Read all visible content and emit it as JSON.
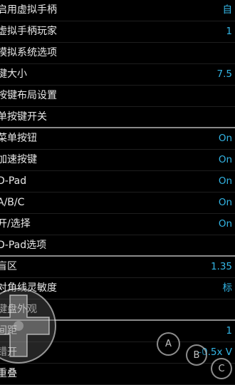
{
  "settings": [
    {
      "label": "启用虚拟手柄",
      "value": "自"
    },
    {
      "label": "虚拟手柄玩家",
      "value": "1"
    },
    {
      "label": "模拟系统选项",
      "value": ""
    },
    {
      "label": "键大小",
      "value": "7.5"
    },
    {
      "label": "按键布局设置",
      "value": ""
    },
    {
      "label": "单按键开关",
      "value": ""
    },
    {
      "label": "菜单按钮",
      "value": "On"
    },
    {
      "label": "加速按键",
      "value": "On"
    },
    {
      "label": "D-Pad",
      "value": "On"
    },
    {
      "label": "A/B/C",
      "value": "On"
    },
    {
      "label": "开/选择",
      "value": "On"
    },
    {
      "label": "D-Pad选项",
      "value": ""
    },
    {
      "label": "盲区",
      "value": "1.35"
    },
    {
      "label": "对角线灵敏度",
      "value": "标"
    },
    {
      "label": "键盘外观",
      "value": ""
    },
    {
      "label": "间距",
      "value": "1"
    },
    {
      "label": "错开",
      "value": "-0.5x V"
    },
    {
      "label": "重叠",
      "value": ""
    }
  ],
  "overlay_buttons": {
    "a": "A",
    "b": "B",
    "c": "C"
  },
  "colors": {
    "accent": "#33b5e5",
    "background": "#000000",
    "text": "#e8e8e8",
    "separator": "#8a8a8a"
  }
}
